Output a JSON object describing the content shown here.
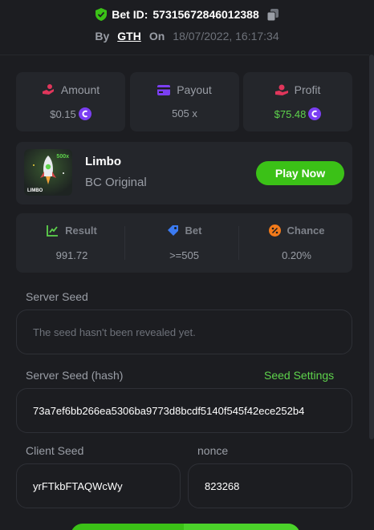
{
  "header": {
    "bet_id_label": "Bet ID:",
    "bet_id": "57315672846012388",
    "by_label": "By",
    "user": "GTH",
    "on_label": "On",
    "date": "18/07/2022, 16:17:34"
  },
  "stats": {
    "amount": {
      "label": "Amount",
      "value": "$0.15"
    },
    "payout": {
      "label": "Payout",
      "value": "505 x"
    },
    "profit": {
      "label": "Profit",
      "value": "$75.48"
    }
  },
  "game": {
    "name": "Limbo",
    "subtitle": "BC Original",
    "play_label": "Play Now",
    "thumb_text": "LIMBO",
    "thumb_badge": "500x"
  },
  "result": {
    "result": {
      "label": "Result",
      "value": "991.72"
    },
    "bet": {
      "label": "Bet",
      "value": ">=505"
    },
    "chance": {
      "label": "Chance",
      "value": "0.20%"
    }
  },
  "seeds": {
    "server_seed_label": "Server Seed",
    "server_seed_placeholder": "The seed hasn't been revealed yet.",
    "server_seed_hash_label": "Server Seed (hash)",
    "seed_settings_label": "Seed Settings",
    "server_seed_hash": "73a7ef6bb266ea5306ba9773d8bcdf5140f545f42ece252b4",
    "client_seed_label": "Client Seed",
    "client_seed": "yrFTkbFTAQWcWy",
    "nonce_label": "nonce",
    "nonce": "823268"
  },
  "colors": {
    "accent_green": "#3bc117",
    "profit_green": "#5ed34c",
    "coin_purple": "#7b3ff2",
    "background": "#1c1d21",
    "card": "#24262b"
  }
}
